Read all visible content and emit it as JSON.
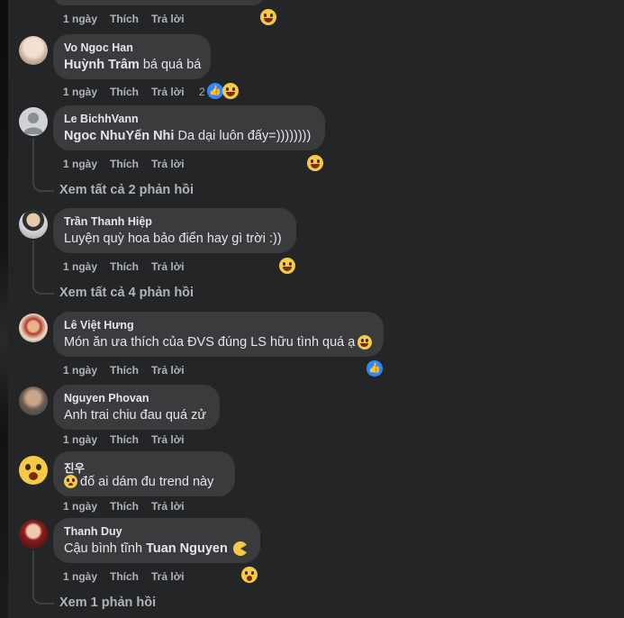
{
  "actions": {
    "time": "1 ngày",
    "like": "Thích",
    "reply": "Trả lời"
  },
  "comments": [
    {
      "author": "",
      "text": ""
    },
    {
      "author": "Vo Ngoc Han",
      "tag": "Huỳnh Trâm",
      "text": " bá quá bá",
      "reaction_count": "2"
    },
    {
      "author": "Le BichhVann",
      "tag": "Ngoc NhuYến Nhi",
      "text": " Da dại luôn đấy=))))))))",
      "replies": "Xem tất cả 2 phản hồi"
    },
    {
      "author": "Trần Thanh Hiệp",
      "text": "Luyện quỳ hoa bảo điển hay gì trời :))",
      "replies": "Xem tất cả 4 phản hồi"
    },
    {
      "author": "Lê Việt Hưng",
      "text": "Món ăn ưa thích của ĐVS đúng LS hữu tình quá ạ"
    },
    {
      "author": "Nguyen Phovan",
      "text": "Anh trai chiu đau quá zử"
    },
    {
      "author": "진우",
      "text": "đố ai dám đu trend này"
    },
    {
      "author": "Thanh Duy",
      "text": "Cậu bình tĩnh ",
      "tag": "Tuan Nguyen",
      "replies": "Xem 1 phản hồi"
    }
  ],
  "icons": [
    "laughing-emoji-icon",
    "like-reaction-icon",
    "default-avatar-icon",
    "crying-emoji-icon",
    "shocked-emoji-icon",
    "pacman-emoji-icon",
    "sweat-smile-emoji-icon"
  ]
}
